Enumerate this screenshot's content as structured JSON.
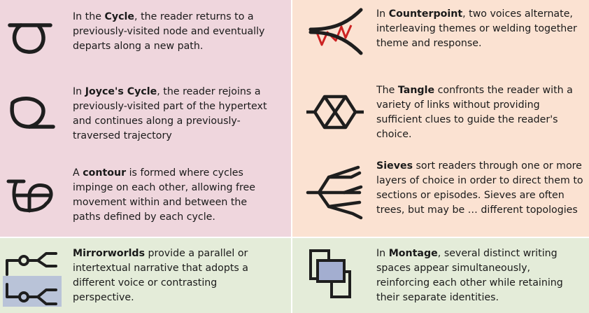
{
  "cells": {
    "cycle": {
      "pre": "In the ",
      "term": "Cycle",
      "post": ", the reader returns to a previously-visited node and eventually departs along a new path."
    },
    "counterpoint": {
      "pre": "In ",
      "term": "Counterpoint",
      "post": ", two voices alternate, interleaving themes or welding together theme and response."
    },
    "joyce": {
      "pre": "In ",
      "term": "Joyce's Cycle",
      "post": ", the reader rejoins a previously-visited part of the hypertext and continues along a previously-traversed trajectory"
    },
    "tangle": {
      "pre": "The ",
      "term": "Tangle",
      "post": " confronts the reader with a variety of links without providing sufficient clues to guide the reader's choice."
    },
    "contour": {
      "pre": "A ",
      "term": "contour",
      "post": " is formed where cycles impinge on each other, allowing free movement within and between the paths defined by each cycle."
    },
    "sieves": {
      "pre": "",
      "term": "Sieves",
      "post": " sort readers through one or more layers of choice in order to direct them to sections or episodes. Sieves are often trees, but may be … different topologies"
    },
    "mirror": {
      "pre": "",
      "term": "Mirrorworlds",
      "post": " provide a parallel or intertextual narrative that adopts a different voice or contrasting perspective."
    },
    "montage": {
      "pre": "In ",
      "term": "Montage",
      "post": ", several distinct writing spaces appear simultaneously, reinforcing each other while retaining their separate identities."
    }
  },
  "icons": {
    "cycle": "cycle-icon",
    "counterpoint": "counterpoint-icon",
    "joyce": "joyce-cycle-icon",
    "tangle": "tangle-icon",
    "contour": "contour-icon",
    "sieves": "sieves-icon",
    "mirror": "mirrorworlds-icon",
    "montage": "montage-icon"
  },
  "colors": {
    "pink": "#efd6dd",
    "peach": "#fbe2d2",
    "green": "#e4ecd9",
    "stroke": "#1e1e1e",
    "accent_red": "#cc2222",
    "mirror_band": "#b9c3d8",
    "montage_fill": "#a3aed0"
  }
}
